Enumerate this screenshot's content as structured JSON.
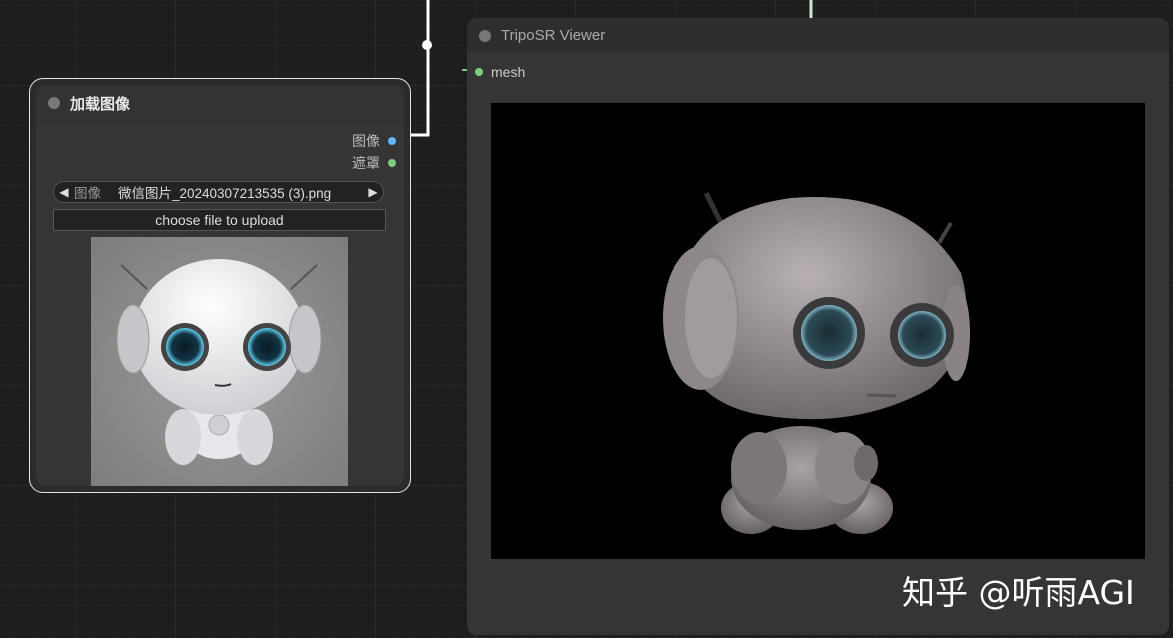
{
  "load_node": {
    "title": "加载图像",
    "outputs": [
      {
        "label": "图像",
        "color": "#64b5f6"
      },
      {
        "label": "遮罩",
        "color": "#7ccf7c"
      }
    ],
    "image_widget": {
      "label": "图像",
      "value": "微信图片_20240307213535 (3).png",
      "prev": "◀",
      "next": "▶"
    },
    "upload_label": "choose file to upload"
  },
  "viewer_node": {
    "title": "TripoSR Viewer",
    "input_label": "mesh"
  },
  "watermark": "知乎 @听雨AGI",
  "icons": [
    "node-status-dot",
    "arrow-left-icon",
    "arrow-right-icon",
    "robot-image",
    "robot-3d-render"
  ]
}
